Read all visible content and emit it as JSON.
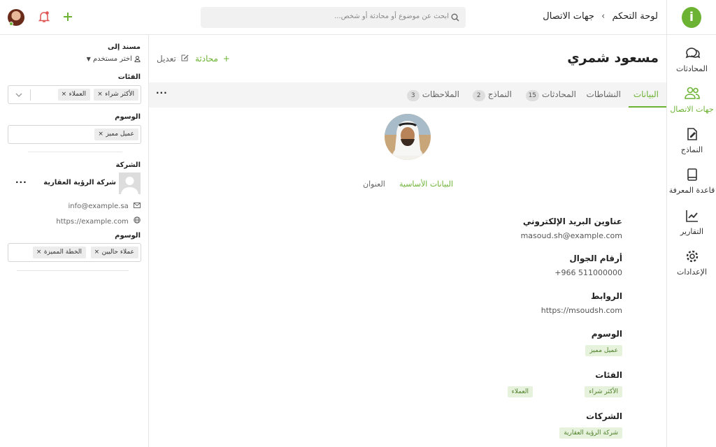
{
  "topbar": {
    "breadcrumb": [
      "لوحة التحكم",
      "جهات الاتصال"
    ],
    "search_placeholder": "ابحث عن موضوع أو محادثة أو شخص..."
  },
  "nav": {
    "items": [
      {
        "label": "المحادثات",
        "icon": "chat-icon",
        "active": false
      },
      {
        "label": "جهات الاتصال",
        "icon": "contacts-icon",
        "active": true
      },
      {
        "label": "النماذج",
        "icon": "forms-icon",
        "active": false
      },
      {
        "label": "قاعدة المعرفة",
        "icon": "book-icon",
        "active": false
      },
      {
        "label": "التقارير",
        "icon": "chart-icon",
        "active": false
      },
      {
        "label": "الإعدادات",
        "icon": "gear-icon",
        "active": false
      }
    ]
  },
  "contact": {
    "name": "مسعود شمري",
    "edit_label": "تعديل",
    "conversation_label": "محادثة",
    "subtabs": [
      "البيانات الأساسية",
      "العنوان"
    ],
    "fields": {
      "email_title": "عناوين البريد الإلكتروني",
      "email": "masoud.sh@example.com",
      "phone_title": "أرقام الجوال",
      "phone": "+966 511000000",
      "links_title": "الروابط",
      "link": "https://msoudsh.com",
      "tags_title": "الوسوم",
      "tags": [
        "عميل مميز"
      ],
      "categories_title": "الفئات",
      "categories": [
        "الأكثر شراء",
        "العملاء"
      ],
      "companies_title": "الشركات",
      "companies": [
        "شركة الرؤية العقارية"
      ]
    }
  },
  "tabs": [
    {
      "label": "البيانات",
      "count": null,
      "active": true
    },
    {
      "label": "النشاطات",
      "count": null,
      "active": false
    },
    {
      "label": "المحادثات",
      "count": "15",
      "active": false
    },
    {
      "label": "النماذج",
      "count": "2",
      "active": false
    },
    {
      "label": "الملاحظات",
      "count": "3",
      "active": false
    }
  ],
  "left": {
    "assigned_label": "مسند إلى",
    "assign_placeholder": "اختر مستخدم",
    "categories_label": "الفئات",
    "categories": [
      "الأكثر شراء",
      "العملاء"
    ],
    "tags_label": "الوسوم",
    "tags": [
      "عميل مميز"
    ],
    "company_label": "الشركة",
    "company_name": "شركة الرؤية العقارية",
    "company_email": "info@example.sa",
    "company_site": "https://example.com",
    "company_tags_label": "الوسوم",
    "company_tags": [
      "عملاء حاليين",
      "الخطة المميزة"
    ]
  },
  "colors": {
    "accent": "#6cb233",
    "notify": "#e05555"
  }
}
